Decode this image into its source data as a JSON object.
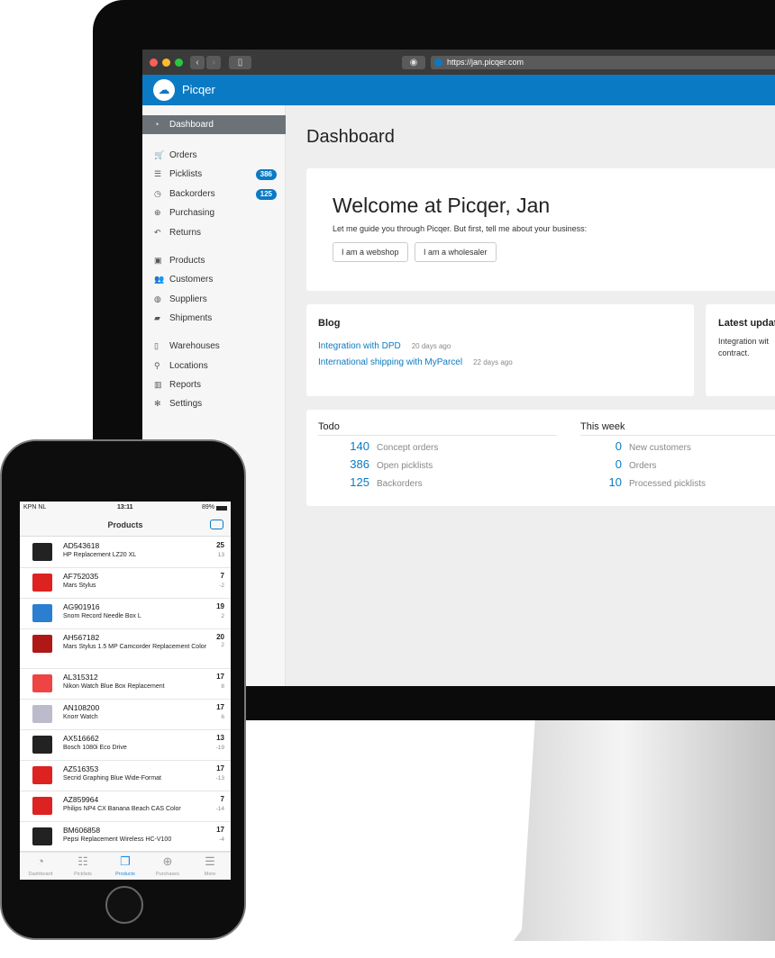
{
  "browser": {
    "url": "https://jan.picqer.com",
    "back": "‹",
    "forward": "›"
  },
  "app": {
    "name": "Picqer",
    "accent": "#0a7ac4"
  },
  "sidebar": {
    "items": [
      {
        "label": "Dashboard",
        "icon": "dashboard-icon",
        "glyph": "◔",
        "active": true
      },
      {
        "label": "Orders",
        "icon": "cart-icon",
        "glyph": "🛒"
      },
      {
        "label": "Picklists",
        "icon": "list-icon",
        "glyph": "☰",
        "badge": "386"
      },
      {
        "label": "Backorders",
        "icon": "clock-icon",
        "glyph": "◷",
        "badge": "125"
      },
      {
        "label": "Purchasing",
        "icon": "download-icon",
        "glyph": "⊕"
      },
      {
        "label": "Returns",
        "icon": "return-icon",
        "glyph": "↶"
      },
      {
        "label": "Products",
        "icon": "image-icon",
        "glyph": "▣"
      },
      {
        "label": "Customers",
        "icon": "users-icon",
        "glyph": "👥"
      },
      {
        "label": "Suppliers",
        "icon": "globe-icon",
        "glyph": "◍"
      },
      {
        "label": "Shipments",
        "icon": "truck-icon",
        "glyph": "▰"
      },
      {
        "label": "Warehouses",
        "icon": "building-icon",
        "glyph": "▯"
      },
      {
        "label": "Locations",
        "icon": "map-marker-icon",
        "glyph": "⚲"
      },
      {
        "label": "Reports",
        "icon": "bar-chart-icon",
        "glyph": "▥"
      },
      {
        "label": "Settings",
        "icon": "gear-icon",
        "glyph": "✻"
      }
    ]
  },
  "main": {
    "title": "Dashboard",
    "welcome": {
      "title": "Welcome at Picqer, Jan",
      "subtitle": "Let me guide you through Picqer. But first, tell me about your business:",
      "buttons": [
        "I am a webshop",
        "I am a wholesaler"
      ]
    },
    "blog": {
      "title": "Blog",
      "posts": [
        {
          "title": "Integration with DPD",
          "ago": "20 days ago"
        },
        {
          "title": "International shipping with MyParcel",
          "ago": "22 days ago"
        }
      ]
    },
    "latest": {
      "title": "Latest updat",
      "text": "Integration wit contract."
    },
    "todo": {
      "title": "Todo",
      "stats": [
        {
          "n": "140",
          "label": "Concept orders"
        },
        {
          "n": "386",
          "label": "Open picklists"
        },
        {
          "n": "125",
          "label": "Backorders"
        }
      ]
    },
    "week": {
      "title": "This week",
      "stats": [
        {
          "n": "0",
          "label": "New customers"
        },
        {
          "n": "0",
          "label": "Orders"
        },
        {
          "n": "10",
          "label": "Processed picklists"
        }
      ]
    }
  },
  "phone": {
    "carrier": "KPN NL",
    "time": "13:11",
    "battery": "89%",
    "title": "Products",
    "products": [
      {
        "sku": "AD543618",
        "name": "HP Replacement LZ20 XL",
        "qty": "25",
        "free": "13",
        "color": "#222"
      },
      {
        "sku": "AF752035",
        "name": "Mars Stylus",
        "qty": "7",
        "free": "-2",
        "color": "#d22"
      },
      {
        "sku": "AG901916",
        "name": "Snom Record Needle Box L",
        "qty": "19",
        "free": "2",
        "color": "#2a7fd0"
      },
      {
        "sku": "AH567182",
        "name": "Mars Stylus 1.5 MP Camcorder Replacement Color",
        "qty": "20",
        "free": "2",
        "color": "#b01818"
      },
      {
        "sku": "AL315312",
        "name": "Nikon Watch Blue Box Replacement",
        "qty": "17",
        "free": "8",
        "color": "#e44"
      },
      {
        "sku": "AN108200",
        "name": "Knorr Watch",
        "qty": "17",
        "free": "6",
        "color": "#bbc"
      },
      {
        "sku": "AX516662",
        "name": "Bosch 1080i Eco Drive",
        "qty": "13",
        "free": "-19",
        "color": "#222"
      },
      {
        "sku": "AZ516353",
        "name": "Secrid Graphing Blue Wide-Format",
        "qty": "17",
        "free": "-13",
        "color": "#d22"
      },
      {
        "sku": "AZ859964",
        "name": "Philips NP4 CX Banana Beach CAS Color",
        "qty": "7",
        "free": "-14",
        "color": "#d22"
      },
      {
        "sku": "BM606858",
        "name": "Pepsi Replacement Wireless HC-V100",
        "qty": "17",
        "free": "-4",
        "color": "#222"
      }
    ],
    "tabs": [
      {
        "label": "Dashboard",
        "glyph": "◔"
      },
      {
        "label": "Picklists",
        "glyph": "☷"
      },
      {
        "label": "Products",
        "glyph": "❐",
        "active": true
      },
      {
        "label": "Purchases",
        "glyph": "⊕"
      },
      {
        "label": "More",
        "glyph": "☰"
      }
    ]
  }
}
